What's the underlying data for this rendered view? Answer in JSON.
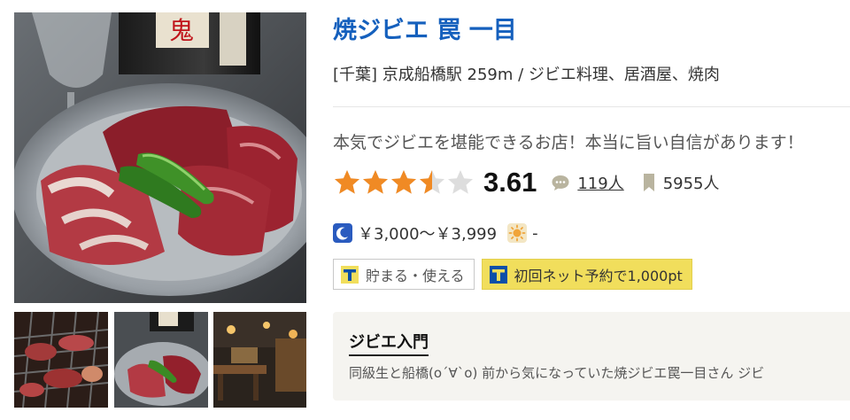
{
  "shop": {
    "name": "焼ジビエ 罠 一目",
    "meta": "[千葉] 京成船橋駅 259m / ジビエ料理、居酒屋、焼肉",
    "catch_copy": "本気でジビエを堪能できるお店！本当に旨い自信があります！"
  },
  "rating": {
    "score": "3.61",
    "stars_filled": 3.61,
    "stars_total": 5,
    "star_color": "#f08a24",
    "star_empty_color": "#dddddd"
  },
  "reviews": {
    "count": "119人",
    "icon": "comment-icon"
  },
  "bookmarks": {
    "count": "5955人",
    "icon": "bookmark-icon"
  },
  "price": {
    "dinner_icon": "moon-icon",
    "dinner": "￥3,000～￥3,999",
    "lunch_icon": "sun-icon",
    "lunch": "-"
  },
  "badges": {
    "tpoint_label": "貯まる・使える",
    "net_reserve_label": "初回ネット予約で1,000pt"
  },
  "review_card": {
    "title": "ジビエ入門",
    "body": "同級生と船橋(o´∀`o) 前から気になっていた焼ジビエ罠一目さん ジビ"
  },
  "colors": {
    "link": "#1560bd",
    "tpoint_blue": "#0a4fa8",
    "tpoint_yellow": "#f1de5c",
    "moon_blue": "#2a5bbf",
    "sun_orange": "#f0a43a"
  }
}
